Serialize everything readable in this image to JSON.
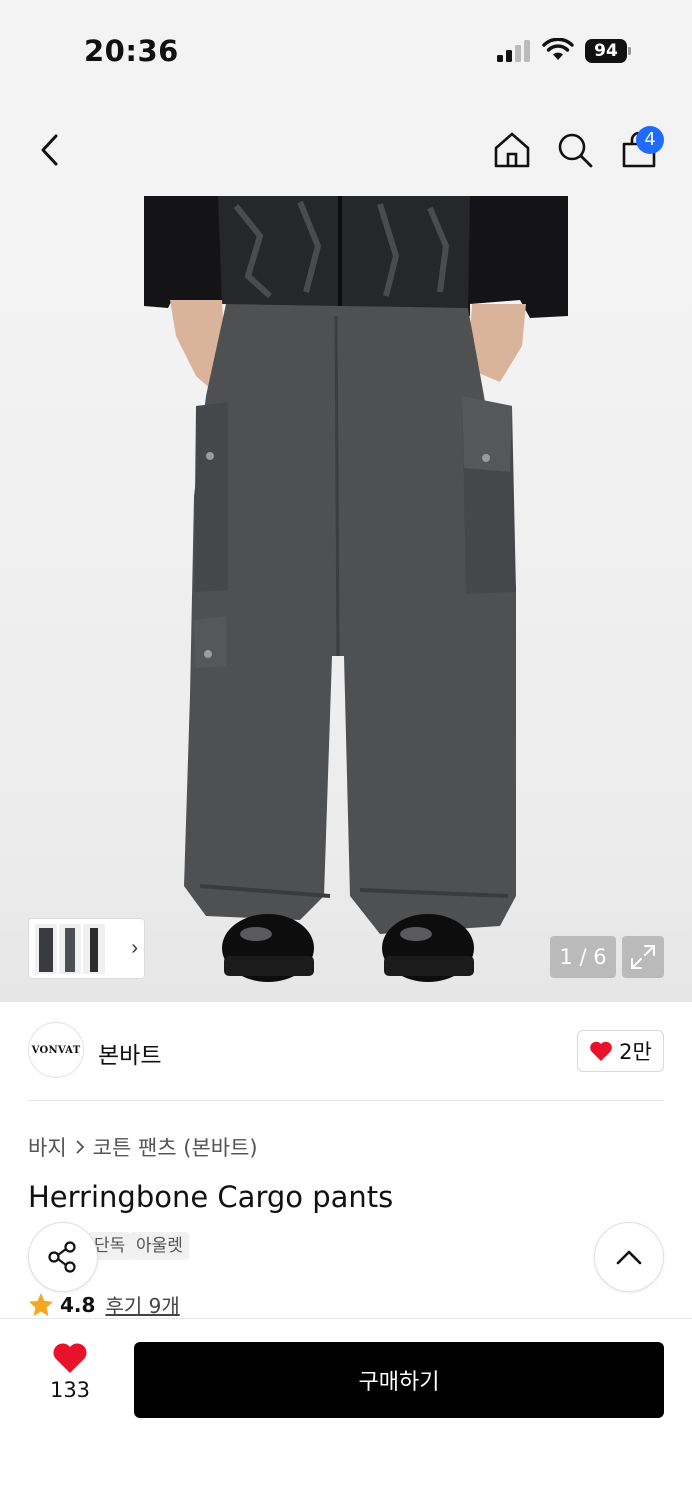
{
  "status_bar": {
    "time": "20:36",
    "battery": "94"
  },
  "nav": {
    "cart_count": "4"
  },
  "gallery": {
    "counter": "1 / 6",
    "thumb_chevron": "›"
  },
  "brand": {
    "logo_text": "VONVAT",
    "name": "본바트",
    "like_count": "2만"
  },
  "product": {
    "breadcrumb": [
      "바지",
      "코튼 팬츠 (본바트)"
    ],
    "title": "Herringbone Cargo pants",
    "tags": [
      "단독",
      "아울렛"
    ],
    "rating": "4.8",
    "review_link": "후기 9개"
  },
  "bottom_bar": {
    "wish_count": "133",
    "buy_label": "구매하기"
  },
  "colors": {
    "accent_blue": "#1f6bff",
    "heart_red": "#e8132b",
    "star_orange": "#f5a623",
    "buy_button": "#000000"
  },
  "icons": [
    "back-arrow-icon",
    "home-icon",
    "search-icon",
    "shopping-bag-icon",
    "expand-icon",
    "heart-icon",
    "share-icon",
    "chevron-up-icon",
    "star-icon",
    "chevron-right-icon"
  ]
}
